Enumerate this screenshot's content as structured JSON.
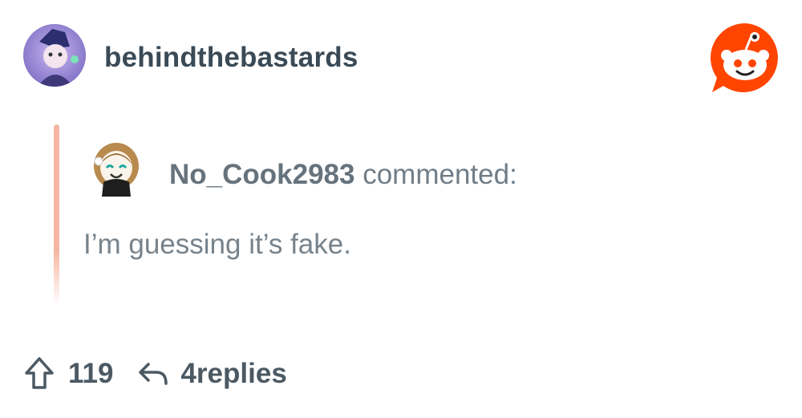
{
  "post": {
    "subreddit_name": "behindthebastards"
  },
  "quoted_comment": {
    "username": "No_Cook2983",
    "action": " commented:",
    "body": "I’m guessing it’s fake."
  },
  "footer": {
    "vote_count": "119",
    "replies_label": "4replies"
  },
  "icons": {
    "upvote": "arrow-up-outline-icon",
    "reply": "reply-arrow-icon",
    "app_logo": "reddit-logo-icon"
  },
  "colors": {
    "reddit_orange": "#ff4500",
    "quote_bar": "#f6b7a2",
    "text_dark": "#3a4a56",
    "text_muted": "#77838c"
  }
}
